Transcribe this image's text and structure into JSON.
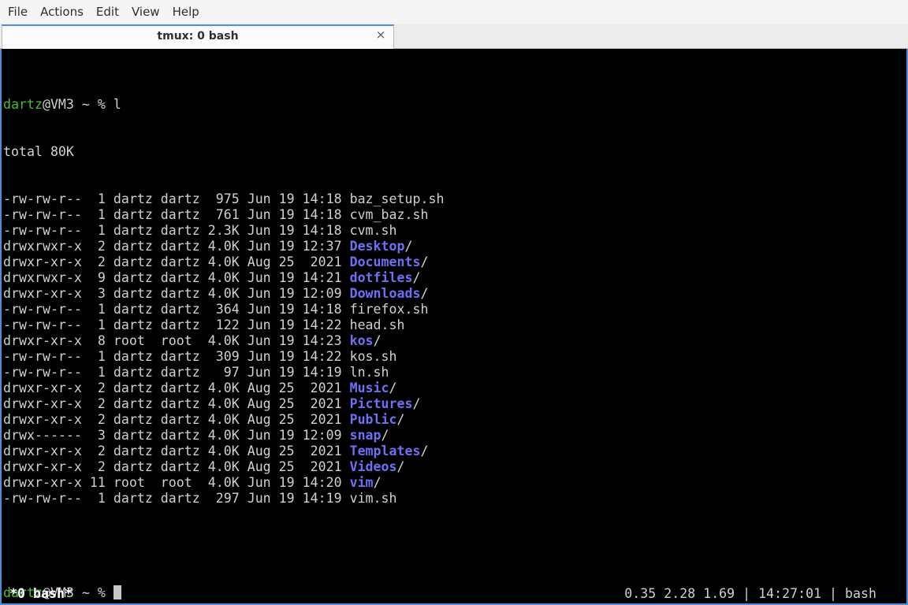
{
  "menu": [
    "File",
    "Actions",
    "Edit",
    "View",
    "Help"
  ],
  "tab": {
    "title": "tmux: 0 bash",
    "close": "×"
  },
  "prompt": {
    "user": "dartz",
    "host_path": "@VM3 ~ % ",
    "command": "l"
  },
  "total": "total 80K",
  "listing": [
    {
      "meta": "-rw-rw-r--  1 dartz dartz  975 Jun 19 14:18 ",
      "name": "baz_setup.sh",
      "dir": false
    },
    {
      "meta": "-rw-rw-r--  1 dartz dartz  761 Jun 19 14:18 ",
      "name": "cvm_baz.sh",
      "dir": false
    },
    {
      "meta": "-rw-rw-r--  1 dartz dartz 2.3K Jun 19 14:18 ",
      "name": "cvm.sh",
      "dir": false
    },
    {
      "meta": "drwxrwxr-x  2 dartz dartz 4.0K Jun 19 12:37 ",
      "name": "Desktop",
      "dir": true
    },
    {
      "meta": "drwxr-xr-x  2 dartz dartz 4.0K Aug 25  2021 ",
      "name": "Documents",
      "dir": true
    },
    {
      "meta": "drwxrwxr-x  9 dartz dartz 4.0K Jun 19 14:21 ",
      "name": "dotfiles",
      "dir": true
    },
    {
      "meta": "drwxr-xr-x  3 dartz dartz 4.0K Jun 19 12:09 ",
      "name": "Downloads",
      "dir": true
    },
    {
      "meta": "-rw-rw-r--  1 dartz dartz  364 Jun 19 14:18 ",
      "name": "firefox.sh",
      "dir": false
    },
    {
      "meta": "-rw-rw-r--  1 dartz dartz  122 Jun 19 14:22 ",
      "name": "head.sh",
      "dir": false
    },
    {
      "meta": "drwxr-xr-x  8 root  root  4.0K Jun 19 14:23 ",
      "name": "kos",
      "dir": true
    },
    {
      "meta": "-rw-rw-r--  1 dartz dartz  309 Jun 19 14:22 ",
      "name": "kos.sh",
      "dir": false
    },
    {
      "meta": "-rw-rw-r--  1 dartz dartz   97 Jun 19 14:19 ",
      "name": "ln.sh",
      "dir": false
    },
    {
      "meta": "drwxr-xr-x  2 dartz dartz 4.0K Aug 25  2021 ",
      "name": "Music",
      "dir": true
    },
    {
      "meta": "drwxr-xr-x  2 dartz dartz 4.0K Aug 25  2021 ",
      "name": "Pictures",
      "dir": true
    },
    {
      "meta": "drwxr-xr-x  2 dartz dartz 4.0K Aug 25  2021 ",
      "name": "Public",
      "dir": true
    },
    {
      "meta": "drwx------  3 dartz dartz 4.0K Jun 19 12:09 ",
      "name": "snap",
      "dir": true
    },
    {
      "meta": "drwxr-xr-x  2 dartz dartz 4.0K Aug 25  2021 ",
      "name": "Templates",
      "dir": true
    },
    {
      "meta": "drwxr-xr-x  2 dartz dartz 4.0K Aug 25  2021 ",
      "name": "Videos",
      "dir": true
    },
    {
      "meta": "drwxr-xr-x 11 root  root  4.0K Jun 19 14:20 ",
      "name": "vim",
      "dir": true
    },
    {
      "meta": "-rw-rw-r--  1 dartz dartz  297 Jun 19 14:19 ",
      "name": "vim.sh",
      "dir": false
    }
  ],
  "dir_suffix": "/",
  "status": {
    "left": "*0 bash*",
    "right": "0.35 2.28 1.69 | 14:27:01 | bash"
  },
  "colors": {
    "user": "#4cbb3c",
    "directory": "#6f6ff5",
    "accent": "#4a90d9",
    "terminal_bg": "#000000"
  }
}
